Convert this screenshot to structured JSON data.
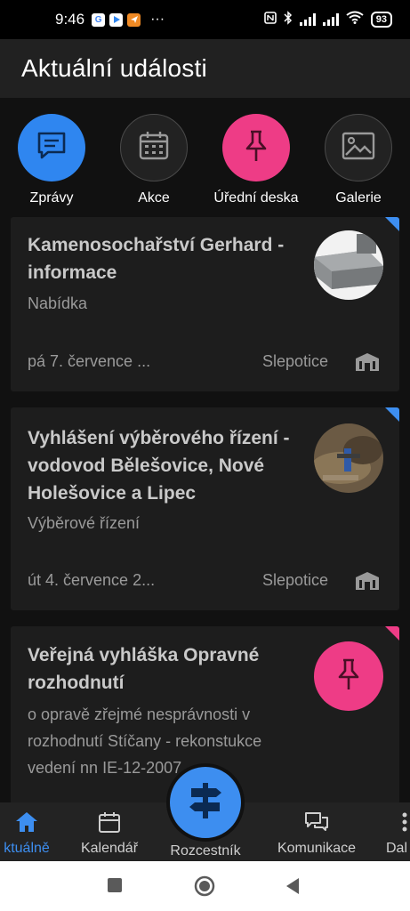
{
  "status_bar": {
    "time": "9:46",
    "battery": "93"
  },
  "header": {
    "title": "Aktuální události"
  },
  "categories": [
    {
      "label": "Zprávy",
      "icon": "chat-icon",
      "color": "#2f86f0"
    },
    {
      "label": "Akce",
      "icon": "calendar-icon",
      "color": "#222222"
    },
    {
      "label": "Úřední deska",
      "icon": "pushpin-icon",
      "color": "#ee3c86"
    },
    {
      "label": "Galerie",
      "icon": "image-icon",
      "color": "#222222"
    }
  ],
  "cards": [
    {
      "title": "Kamenosochařství Gerhard - informace",
      "category": "Nabídka",
      "date": "pá 7. července ...",
      "place": "Slepotice",
      "corner_color": "#3d8ef0"
    },
    {
      "title": "Vyhlášení výběrového řízení - vodovod Bělešovice, Nové Holešovice a Lipec",
      "category": "Výběrové řízení",
      "date": "út 4. července 2...",
      "place": "Slepotice",
      "corner_color": "#3d8ef0"
    },
    {
      "title": "Veřejná vyhláška Opravné rozhodnutí",
      "description": "o opravě zřejmé nesprávnosti v rozhodnutí Stíčany - rekonstukce vedení nn IE-12-2007...",
      "corner_color": "#ee3c86"
    }
  ],
  "bottom_nav": {
    "items": [
      {
        "label": "ktuálně",
        "icon": "home-icon",
        "active": true
      },
      {
        "label": "Kalendář",
        "icon": "calendar-icon",
        "active": false
      },
      {
        "label": "Rozcestník",
        "icon": "signpost-icon",
        "active": false
      },
      {
        "label": "Komunikace",
        "icon": "chat-bubbles-icon",
        "active": false
      },
      {
        "label": "Dal",
        "icon": "more-icon",
        "active": false
      }
    ]
  },
  "colors": {
    "accent": "#3d8ef0",
    "pink": "#ee3c86",
    "background": "#111111",
    "card": "#1d1d1d"
  }
}
